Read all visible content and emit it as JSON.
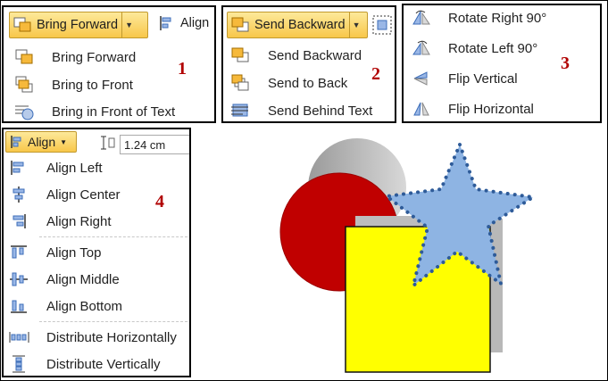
{
  "panel1": {
    "number": "1",
    "button_label": "Bring Forward",
    "toolbar_partial": "Align",
    "items": [
      {
        "label": "Bring Forward",
        "icon": "bring-forward-icon"
      },
      {
        "label": "Bring to Front",
        "icon": "bring-to-front-icon"
      },
      {
        "label": "Bring in Front of Text",
        "icon": "bring-in-front-of-text-icon"
      }
    ]
  },
  "panel2": {
    "number": "2",
    "button_label": "Send Backward",
    "items": [
      {
        "label": "Send Backward",
        "icon": "send-backward-icon"
      },
      {
        "label": "Send to Back",
        "icon": "send-to-back-icon"
      },
      {
        "label": "Send Behind Text",
        "icon": "send-behind-text-icon"
      }
    ]
  },
  "panel3": {
    "number": "3",
    "items": [
      {
        "label": "Rotate Right 90°",
        "icon": "rotate-right-icon"
      },
      {
        "label": "Rotate Left 90°",
        "icon": "rotate-left-icon"
      },
      {
        "label": "Flip Vertical",
        "icon": "flip-vertical-icon"
      },
      {
        "label": "Flip Horizontal",
        "icon": "flip-horizontal-icon"
      }
    ]
  },
  "panel4": {
    "number": "4",
    "button_label": "Align",
    "size_value": "1.24 cm",
    "items": [
      {
        "label": "Align Left",
        "icon": "align-left-icon"
      },
      {
        "label": "Align Center",
        "icon": "align-center-icon"
      },
      {
        "label": "Align Right",
        "icon": "align-right-icon"
      },
      {
        "label": "Align Top",
        "icon": "align-top-icon"
      },
      {
        "label": "Align Middle",
        "icon": "align-middle-icon"
      },
      {
        "label": "Align Bottom",
        "icon": "align-bottom-icon"
      },
      {
        "label": "Distribute Horizontally",
        "icon": "distribute-horizontally-icon"
      },
      {
        "label": "Distribute Vertically",
        "icon": "distribute-vertically-icon"
      }
    ]
  },
  "colors": {
    "button_gradient_top": "#fde99a",
    "button_gradient_bottom": "#f8c74a",
    "number_red": "#b10000",
    "circle_red": "#c00000",
    "square_yellow": "#ffff00",
    "star_blue": "#8eb4e3",
    "dot_border": "#2e5b99"
  }
}
